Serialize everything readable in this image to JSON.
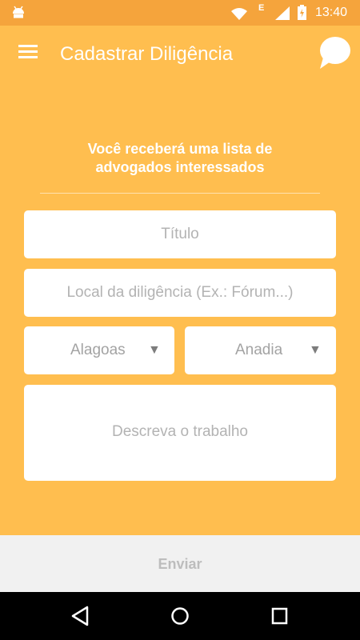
{
  "status_bar": {
    "time": "13:40",
    "network_type": "E",
    "icons": [
      "android-icon",
      "wifi-icon",
      "signal-icon",
      "battery-icon"
    ]
  },
  "app_bar": {
    "title": "Cadastrar Diligência",
    "icons": [
      "menu-icon",
      "chat-bubble-icon"
    ]
  },
  "form": {
    "info_line1": "Você receberá uma lista de",
    "info_line2": "advogados interessados",
    "titulo_placeholder": "Título",
    "local_placeholder": "Local da diligência (Ex.: Fórum...)",
    "state_value": "Alagoas",
    "city_value": "Anadia",
    "descricao_placeholder": "Descreva o trabalho"
  },
  "send": {
    "label": "Enviar"
  },
  "colors": {
    "background": "#FFBE4F",
    "status_bar": "#F5A43C",
    "send_bar": "#F1F1F1",
    "placeholder": "#B3B3B3"
  },
  "nav_bar": {
    "icons": [
      "back-icon",
      "home-icon",
      "recents-icon"
    ]
  }
}
